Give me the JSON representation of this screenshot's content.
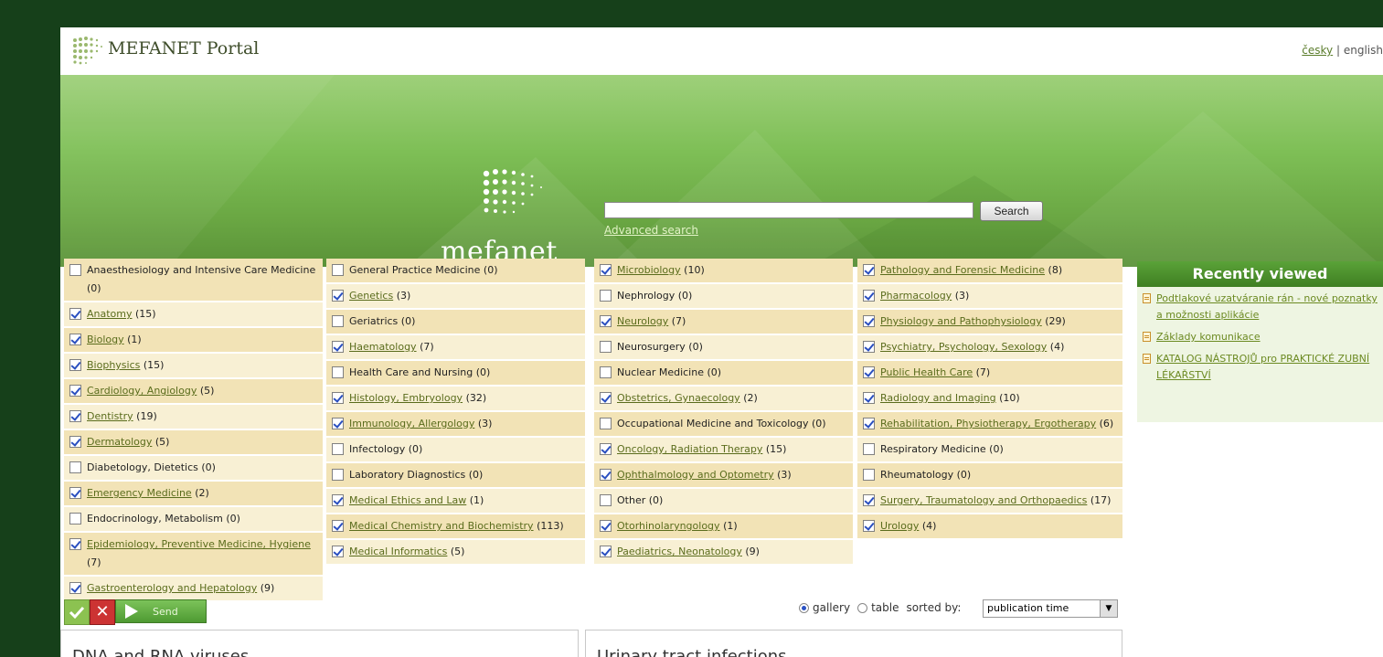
{
  "header": {
    "portal_title": "MEFANET Portal",
    "lang_cz": "česky",
    "lang_sep": "|",
    "lang_en": "english"
  },
  "banner": {
    "logo_text": "mefanet"
  },
  "search": {
    "button_label": "Search",
    "advanced_label": "Advanced search",
    "value": ""
  },
  "categories": {
    "col1": [
      {
        "name": "Anaesthesiology and Intensive Care Medicine",
        "count": "(0)",
        "checked": false
      },
      {
        "name": "Anatomy",
        "count": "(15)",
        "checked": true
      },
      {
        "name": "Biology",
        "count": "(1)",
        "checked": true
      },
      {
        "name": "Biophysics",
        "count": "(15)",
        "checked": true
      },
      {
        "name": "Cardiology, Angiology",
        "count": "(5)",
        "checked": true
      },
      {
        "name": "Dentistry",
        "count": "(19)",
        "checked": true
      },
      {
        "name": "Dermatology",
        "count": "(5)",
        "checked": true
      },
      {
        "name": "Diabetology, Dietetics",
        "count": "(0)",
        "checked": false
      },
      {
        "name": "Emergency Medicine",
        "count": "(2)",
        "checked": true
      },
      {
        "name": "Endocrinology, Metabolism",
        "count": "(0)",
        "checked": false
      },
      {
        "name": "Epidemiology, Preventive Medicine, Hygiene",
        "count": "(7)",
        "checked": true
      },
      {
        "name": "Gastroenterology and Hepatology",
        "count": "(9)",
        "checked": true
      }
    ],
    "col2": [
      {
        "name": "General Practice Medicine",
        "count": "(0)",
        "checked": false
      },
      {
        "name": "Genetics",
        "count": "(3)",
        "checked": true
      },
      {
        "name": "Geriatrics",
        "count": "(0)",
        "checked": false
      },
      {
        "name": "Haematology",
        "count": "(7)",
        "checked": true
      },
      {
        "name": "Health Care and Nursing",
        "count": "(0)",
        "checked": false
      },
      {
        "name": "Histology, Embryology",
        "count": "(32)",
        "checked": true
      },
      {
        "name": "Immunology, Allergology",
        "count": "(3)",
        "checked": true
      },
      {
        "name": "Infectology",
        "count": "(0)",
        "checked": false
      },
      {
        "name": "Laboratory Diagnostics",
        "count": "(0)",
        "checked": false
      },
      {
        "name": "Medical Ethics and Law",
        "count": "(1)",
        "checked": true
      },
      {
        "name": "Medical Chemistry and Biochemistry",
        "count": "(113)",
        "checked": true
      },
      {
        "name": "Medical Informatics",
        "count": "(5)",
        "checked": true
      }
    ],
    "col3": [
      {
        "name": "Microbiology",
        "count": "(10)",
        "checked": true
      },
      {
        "name": "Nephrology",
        "count": "(0)",
        "checked": false
      },
      {
        "name": "Neurology",
        "count": "(7)",
        "checked": true
      },
      {
        "name": "Neurosurgery",
        "count": "(0)",
        "checked": false
      },
      {
        "name": "Nuclear Medicine",
        "count": "(0)",
        "checked": false
      },
      {
        "name": "Obstetrics, Gynaecology",
        "count": "(2)",
        "checked": true
      },
      {
        "name": "Occupational Medicine and Toxicology",
        "count": "(0)",
        "checked": false
      },
      {
        "name": "Oncology, Radiation Therapy",
        "count": "(15)",
        "checked": true
      },
      {
        "name": "Ophthalmology and Optometry",
        "count": "(3)",
        "checked": true
      },
      {
        "name": "Other",
        "count": "(0)",
        "checked": false
      },
      {
        "name": "Otorhinolaryngology",
        "count": "(1)",
        "checked": true
      },
      {
        "name": "Paediatrics, Neonatology",
        "count": "(9)",
        "checked": true
      }
    ],
    "col4": [
      {
        "name": "Pathology and Forensic Medicine",
        "count": "(8)",
        "checked": true
      },
      {
        "name": "Pharmacology",
        "count": "(3)",
        "checked": true
      },
      {
        "name": "Physiology and Pathophysiology",
        "count": "(29)",
        "checked": true
      },
      {
        "name": "Psychiatry, Psychology, Sexology",
        "count": "(4)",
        "checked": true
      },
      {
        "name": "Public Health Care",
        "count": "(7)",
        "checked": true
      },
      {
        "name": "Radiology and Imaging",
        "count": "(10)",
        "checked": true
      },
      {
        "name": "Rehabilitation, Physiotherapy, Ergotherapy",
        "count": "(6)",
        "checked": true
      },
      {
        "name": "Respiratory Medicine",
        "count": "(0)",
        "checked": false
      },
      {
        "name": "Rheumatology",
        "count": "(0)",
        "checked": false
      },
      {
        "name": "Surgery, Traumatology and Orthopaedics",
        "count": "(17)",
        "checked": true
      },
      {
        "name": "Urology",
        "count": "(4)",
        "checked": true
      }
    ]
  },
  "recent": {
    "title": "Recently viewed",
    "items": [
      {
        "label": "Podtlakové uzatváranie rán - nové poznatky a možnosti aplikácie"
      },
      {
        "label": "Základy komunikace"
      },
      {
        "label": "KATALOG NÁSTROJŮ pro PRAKTICKÉ ZUBNÍ LÉKAŘSTVÍ"
      }
    ]
  },
  "controls": {
    "send_label": "Send",
    "gallery_label": "gallery",
    "table_label": "table",
    "sorted_by_label": "sorted by:",
    "sort_value": "publication time",
    "view_mode": "gallery"
  },
  "panels": [
    {
      "title": "DNA and RNA viruses"
    },
    {
      "title": "Urinary tract infections"
    }
  ],
  "colors": {
    "outer_bg": "#16401a",
    "accent_green": "#4e9a32",
    "category_bg": "#f2e3b6",
    "link": "#5a6c1c"
  }
}
